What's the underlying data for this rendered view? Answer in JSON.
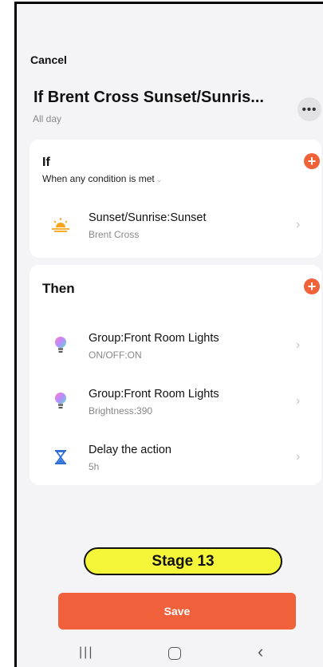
{
  "header": {
    "cancel_label": "Cancel",
    "title": "If Brent Cross Sunset/Sunris...",
    "subtitle": "All day",
    "more_label": "•••"
  },
  "if_card": {
    "title": "If",
    "condition_mode": "When any condition is met",
    "add_label": "+",
    "conditions": [
      {
        "title": "Sunset/Sunrise:Sunset",
        "subtitle": "Brent Cross",
        "icon": "sunset-icon"
      }
    ]
  },
  "then_card": {
    "title": "Then",
    "add_label": "+",
    "actions": [
      {
        "title": "Group:Front Room Lights",
        "subtitle": "ON/OFF:ON",
        "icon": "bulb-icon"
      },
      {
        "title": "Group:Front Room Lights",
        "subtitle": "Brightness:390",
        "icon": "bulb-icon"
      },
      {
        "title": "Delay the action",
        "subtitle": "5h",
        "icon": "hourglass-icon"
      }
    ]
  },
  "overlay": {
    "stage_label": "Stage 13"
  },
  "footer": {
    "save_label": "Save"
  },
  "colors": {
    "accent": "#f0603b",
    "badge": "#f5f53a",
    "background": "#f4f4f6"
  }
}
